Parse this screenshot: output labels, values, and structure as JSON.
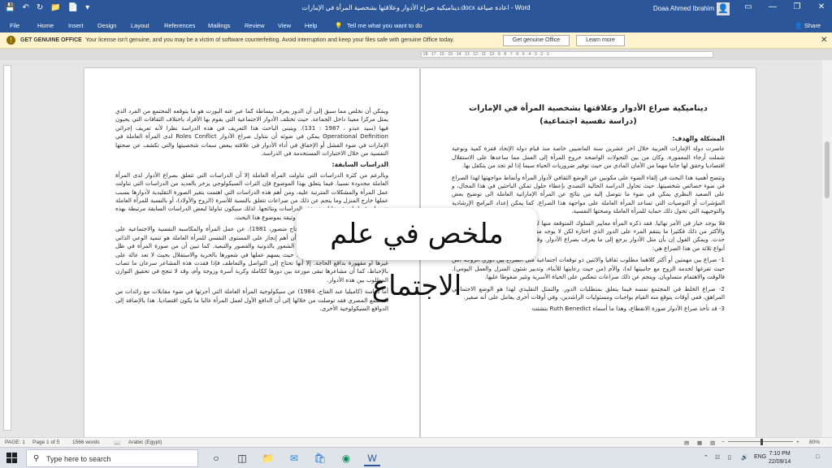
{
  "window": {
    "title": "ديناميكية صراع الأدوار وعلاقتها بشخصية المرأة في الإمارات.docx  اعادة صياغة - Word",
    "user": "Doaa Ahmed Ibrahim",
    "controls": {
      "minimize": "—",
      "restore": "❐",
      "close": "✕",
      "ribbon_options": "▭"
    }
  },
  "ribbon": {
    "tabs": [
      "File",
      "Home",
      "Insert",
      "Design",
      "Layout",
      "References",
      "Mailings",
      "Review",
      "View",
      "Help"
    ],
    "tell_me": "Tell me what you want to do",
    "share": "Share"
  },
  "infobar": {
    "label": "GET GENUINE OFFICE",
    "message": "Your license isn't genuine, and you may be a victim of software counterfeiting. Avoid interruption and keep your files safe with genuine Office today.",
    "button_primary": "Get genuine Office",
    "button_secondary": "Learn more"
  },
  "ruler": {
    "ticks": "·18· ·17· ·16· ·15· ·14· ·13· ·12· ·11· ·10· ·9· ·8· ·7· ·6· ·5· ·4· ·3· ·2· ·1· ·"
  },
  "document": {
    "right_page": {
      "title_line1": "ديناميكية صراع الأدوار وعلاقتها بشخصية المرأة في الإمارات",
      "title_line2": "(دراسة نفسية اجتماعية)",
      "heading1": "المشكلة والهدف:",
      "para1": "عاصرت دولة الإمارات العربية خلال اخر عشرين سنة الماضيين خاصة منذ قيام دولة الإتحاد قفزة كمية ونوعية شملت أرجاء المعمورة. وكان من بين التحولات الواضحة خروج المرأة إلى العمل مما ساعدها على الاستقلال اقتصاديا وحقق لها جانبا مهما من الأمان المادي من حيث توفير ضروريات الحياة سيما إذا لم تجد من يتكفل بها.",
      "para2": "وتتضح أهمية هذا البحث في إلقاء الضوء على مكونين عن الوضع الثقافي لأدوار المرأة وأنماط مواجهتها لهذا الصراع في ضوء خصائص شخصيتها. حيث تحاول الدراسة الحالية التصدي بإعطاء حلول تمكن الباحثين في هذا المجال، و على الصعيد النظري يمكن في ضوء ما نتوصل إليه من نتائج عن المرأة الإماراتية العاملة الى توضيح بعض المؤشرات أو التوصيات التي تساعد المرأة العاملة على مواجهة هذا الصراع. كما يمكن إعداد البرامج الإرشادية والتوجيهية التي تحول ذلك حماية للمرأة العاملة وصحتها النفسية.",
      "para3": "فلا يوجد خيار في الأمر نهائيا. فقد ذكره المرأة معايير السلوك المتوقعة منها لكونها إمرأة لكنها لا تملك أي اختيار. والأكثر من ذلك فكثيرا ما ينتقم المرء على الدور الذي اختاره لكن لا يوجد مفر من هذا الاختيار بعد أن يكون قد حدث. ويمكن القول إن بأن مثل الأدوار يرجع إلى ما يعرف بصراع الأدوار. وقد ميز (Cuber, 1963 : 304) بين أنواع ثلاثة من هذا الصراع هي:",
      "item1": "1- صراع بين مهمتين أو أكثر كلاهما مطلوب ثقافيا والاثنين ذو توقعات اجتماعية مثل الصراع بين دوري الزوجة (من حيث تفرغها لخدمة الزوج مع جانبيتها له)، والأم (من حيث رعايتها للأبناء، وتدبير شئون المنزل والعمل اليومي). فالوقت والاهتمام متساويان. وينجم عن ذلك صراعات تنعكس على الحياة الأسرية وتثير ضغوطا عليها.",
      "item2": "2- صراع الخلط في المجتمع نفسه فيما يتعلق بمتطلبات الدور. والتمثل التقليدي لهذا هو الوضع الاجتماعي المراهق، ففي أوقات يتوقع منه القيام بواجبات ومسئوليات الراشدين، وفي أوقات أخرى يعامل على أنه صغير.",
      "item3": "3- قد تأخذ صراع الأدوار صورة الانقطاع، وهذا ما أسماه Ruth Benedict بتشتت"
    },
    "left_page": {
      "para1": "ويمكن أن نخلص مما سبق إلى أن الدور يعرف ببساطة كما عبر عنه البورت هو ما يتوقعه المجتمع من الفرد الذي يمثل مركزا معينا داخل الجماعة. حيث تختلف الأدوار الاجتماعية التي يقوم بها الأفراد باختلاف الثقافات التي يحيون فيها (سيد عبدو ، 1987 : 131). ويتبنى الباحث هذا التعريف في هذه الدراسة نظرا لأنه تعريف إجرائي Operational Definition يمكن في ضوئه أن نتناول صراع الأدوار Roles Conflict لدى المرأة العاملة في الإمارات في ضوء الفشل أو الإخفاق في أداء الأدوار في علاقته ببعض سمات شخصيتها والتي تكشف عن صحتها النفسية من خلال الاختبارات المستخدمة في الدراسة.",
      "heading1": "الدراسات السابقة:",
      "para2": "وبالرغم من كثرة الدراسات التي تناولت المرأة العاملة إلا أن الدراسات التي تتعلق بصراع الأدوار لدى المرأة العاملة محدودة نسبيا. فيما يتعلق بهذا الموضوع فإن التراث السيكولوجي يزخر بالعديد من الدراسات التي تناولت عمل المرأة والمشكلات المترتبة عليه، ومن أهم هذه الدراسات التي اهتمت بتغير الصورة التقليدية لأدوارها بسبب عملها خارج المنزل وما ينجم عن ذلك من صراعات تتعلق بالنسبة للأسرة (الزوج والأولاد)، أو بالنسبة للمرأة العاملة نفسها، وفيما يلي عرضا لبعض هذه الدراسات ونتائجها. لذلك سيكون تناولنا لبعض الدراسات السابقة مرتبطة بهذه الجوانب مباشرة والتي تبدو ذات علاقة وثيقة بموضوع هذا البحث.",
      "para3": "وفي هذا الإطار أيضا كانت دراسة (نجاح منصور، 1981). عن عمل المرأة والمكاسبه النفسية والاجتماعية على شخصيتها. وقد تبين من هذه الدراسة أن أهم إنجاز على المستوى النفسي للمرأة العاملة هو تنمية الوعي الذاتي لديها وإدراكها لقيمتها مما يخلصها من الشعور بالدونية والقصور والتبعية. كما تبين أن من صورة المرأة في ظل العمل تكون أكثر إشراقا وتفاؤلا وثقة. حيث يسهم عملها في شعورها بالحرية والاستقلال بحيث لا تعد عالة على غيرها أو مقهورة بدافع الحاجة. إلا أنها تحتاج إلى التواصل والتعاطف فإذا فقدت هذه المشاعر سرعان ما تصاب بالإحباط، كما أن مشاعرها تبقى موزعة بين دورها ككاملة وكربة أسرة وزوجة وأم، وقد لا تنجح في تحقيق التوازن المطلوب بين هذه الأدوار.",
      "para4": "أما دراسة (كاميليا عبد الفتاح، 1984) عن سيكولوجية المرأة العاملة التي أجرتها في ضوء مقابلات مع زائدات من المجتمع المصري فقد توصلت من خلالها إلى أن الدافع الأول لعمل المرأة غالبا ما يكون اقتصاديا. هذا بالإضافة إلى الدوافع السيكولوجية الأخرى."
    }
  },
  "overlay": {
    "text": "ملخص في علم الاجتماع"
  },
  "statusbar": {
    "page_label": "PAGE: 1",
    "page_of": "Page 1 of 5",
    "words": "1566 words",
    "language": "Arabic (Egypt)",
    "zoom": "80%"
  },
  "taskbar": {
    "search_placeholder": "Type here to search",
    "language": "ENG",
    "time": "7:10 PM",
    "date": "22/09/14"
  }
}
